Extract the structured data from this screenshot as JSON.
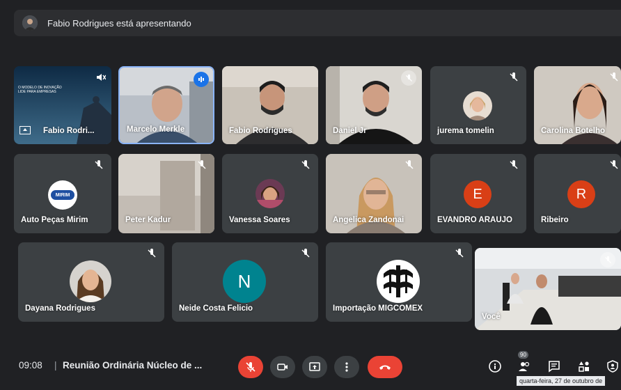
{
  "presenting": {
    "text": "Fabio Rodrigues está apresentando"
  },
  "participants": [
    {
      "name": "Fabio Rodri...",
      "slide_title": "O MODELO DE INOVAÇÃO\nLIDE PARA EMPRESAS"
    },
    {
      "name": "Marcelo Merkle"
    },
    {
      "name": "Fabio Rodrigues"
    },
    {
      "name": "Daniel Jr"
    },
    {
      "name": "jurema tomelin"
    },
    {
      "name": "Carolina Botelho"
    },
    {
      "name": "Auto Peças Mirim",
      "logo_text": "MIRIM"
    },
    {
      "name": "Peter Kadur"
    },
    {
      "name": "Vanessa Soares"
    },
    {
      "name": "Angelica Zandonai"
    },
    {
      "name": "EVANDRO ARAUJO",
      "initial": "E"
    },
    {
      "name": "Ribeiro",
      "initial": "R"
    },
    {
      "name": "Dayana Rodrigues"
    },
    {
      "name": "Neide Costa Felicio",
      "initial": "N"
    },
    {
      "name": "Importação MIGCOMEX"
    },
    {
      "name": "Você"
    }
  ],
  "bottom": {
    "time": "09:08",
    "separator": "|",
    "meeting_title": "Reunião Ordinária Núcleo de ...",
    "people_count": "90",
    "tooltip": "quarta-feira, 27 de outubro de"
  },
  "colors": {
    "background": "#202124",
    "tile": "#3c4043",
    "red": "#ea4335",
    "orange_avatar": "#d93f16",
    "teal_avatar": "#00838f",
    "blue": "#1a73e8"
  },
  "icons": [
    "mic-off-icon",
    "camera-icon",
    "present-icon",
    "more-icon",
    "hangup-icon",
    "info-icon",
    "people-icon",
    "chat-icon",
    "activities-icon",
    "host-controls-icon"
  ]
}
